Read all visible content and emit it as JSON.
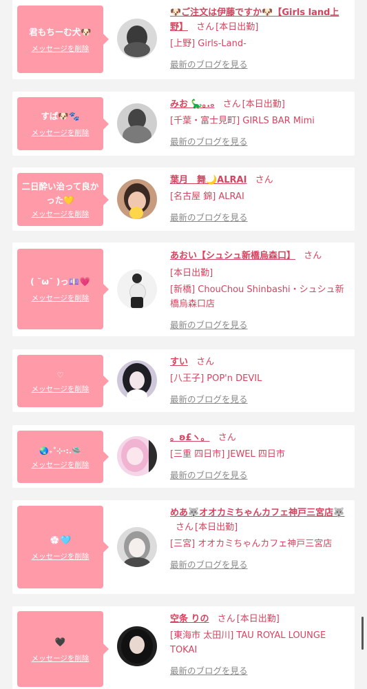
{
  "delete_label": "メッセージを削除",
  "blog_label": "最新のブログを見る",
  "san_label": "さん",
  "cards": [
    {
      "message": "君もちーむ犬🐶",
      "name": "🐶ご注文は伊藤ですか🐶【Girls land上野】",
      "attendance": "[本日出勤]",
      "shop": "[上野] Girls-Land-"
    },
    {
      "message": "すば🐶🐾",
      "name": "みお 🦕｡.ₒ",
      "attendance": "[本日出勤]",
      "shop": "[千葉・富士見町] GIRLS BAR Mimi"
    },
    {
      "message": "二日酔い治って良かった💛",
      "name": "葉月　舞🌙ALRAI",
      "attendance": "",
      "shop": "[名古屋 錦] ALRAI"
    },
    {
      "message": "( ˘ω˘ )っ💷💗",
      "name": "あおい【シュシュ新橋烏森口】",
      "attendance": "[本日出勤]",
      "shop": "[新橋] ChouChou Shinbashi・シュシュ新橋烏森口店"
    },
    {
      "message": "♡",
      "name": "すい",
      "attendance": "",
      "shop": "[八王子] POP'n DEVIL"
    },
    {
      "message": "🌏₊˚⊹·:.🛸",
      "name": "。ʚ£ヽ。",
      "attendance": "",
      "shop": "[三重 四日市] JEWEL 四日市"
    },
    {
      "message": "💮🩵",
      "name": "めあ🐺オオカミちゃんカフェ神戸三宮店🐺",
      "attendance": "[本日出勤]",
      "shop": "[三宮] オオカミちゃんカフェ神戸三宮店"
    },
    {
      "message": "🖤",
      "name": "空条 りの",
      "attendance": "[本日出勤]",
      "shop": "[東海市 太田川] TAU ROYAL LOUNGE TOKAI"
    }
  ]
}
